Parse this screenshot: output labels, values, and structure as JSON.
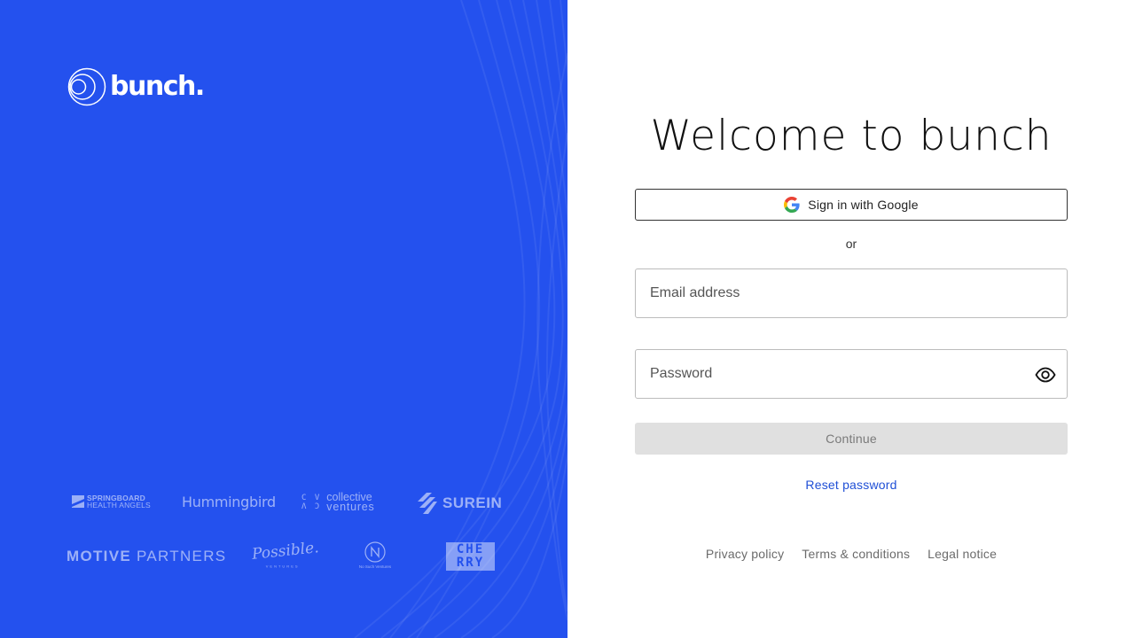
{
  "brand": {
    "logo_text": "bunch.",
    "color": "#2451ee"
  },
  "investors": {
    "springboard": {
      "line1": "SPRINGBOARD",
      "line2": "HEALTH ANGELS"
    },
    "hummingbird": "Hummingbird",
    "collective": {
      "mark_line1": "C V",
      "mark_line2": "Λ Ɔ",
      "line1": "collective",
      "line2": "ventures"
    },
    "surein": "SUREIN",
    "motive": {
      "bold": "MOTIVE",
      "rest": " PARTNERS"
    },
    "possible": {
      "name": "Possible.",
      "sub": "VENTURES"
    },
    "nosuch": "No Such Ventures",
    "cherry": {
      "line1": "CHE",
      "line2": "RRY"
    }
  },
  "login": {
    "title": "Welcome to bunch",
    "google_label": "Sign in with Google",
    "divider": "or",
    "email_placeholder": "Email address",
    "password_placeholder": "Password",
    "continue_label": "Continue",
    "reset_label": "Reset password"
  },
  "footer": {
    "privacy": "Privacy policy",
    "terms": "Terms & conditions",
    "legal": "Legal notice"
  },
  "icons": {
    "google": "google-g-icon",
    "eye": "eye-icon",
    "logo": "bunch-circles-logo-icon"
  }
}
